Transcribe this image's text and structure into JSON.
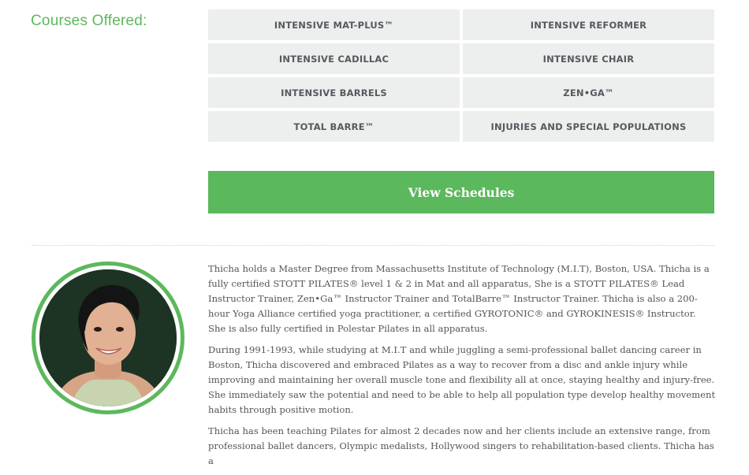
{
  "section": {
    "heading": "Courses Offered:"
  },
  "courses": [
    "INTENSIVE MAT-PLUS™",
    "INTENSIVE REFORMER",
    "INTENSIVE CADILLAC",
    "INTENSIVE CHAIR",
    "INTENSIVE BARRELS",
    "ZEN•GA™",
    "TOTAL BARRE™",
    "INJURIES AND SPECIAL POPULATIONS"
  ],
  "cta": {
    "label": "View Schedules"
  },
  "bio": {
    "paragraphs": [
      "Thicha holds a Master Degree from Massachusetts Institute of Technology (M.I.T), Boston, USA. Thicha is a fully certified STOTT PILATES® level 1 & 2 in Mat and all apparatus, She is a STOTT PILATES® Lead Instructor Trainer, Zen•Ga™ Instructor Trainer and TotalBarre™ Instructor Trainer. Thicha is also a 200-hour Yoga Alliance certified yoga practitioner, a certified GYROTONIC® and GYROKINESIS® Instructor. She is also fully certified in Polestar Pilates in all apparatus.",
      "During 1991-1993, while studying at M.I.T and while juggling a semi-professional ballet dancing career in Boston, Thicha discovered and embraced Pilates as a way to recover from a disc and ankle injury while improving and maintaining her overall muscle tone and flexibility all at once, staying healthy and injury-free. She immediately saw the potential and need to be able to help all population type develop healthy movement habits through positive motion.",
      "Thicha has been teaching Pilates for almost 2 decades now and her clients include an extensive range, from professional ballet dancers, Olympic medalists, Hollywood singers to rehabilitation-based clients. Thicha has a"
    ]
  },
  "colors": {
    "accent": "#5cb85c",
    "cell_bg": "#ecefee",
    "text": "#555555"
  }
}
